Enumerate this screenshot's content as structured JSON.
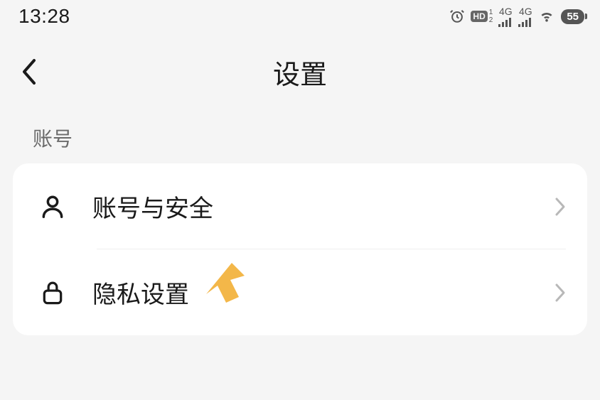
{
  "status": {
    "time": "13:28",
    "hd_label": "HD",
    "sim1": "1",
    "sim2": "2",
    "net1": "4G",
    "net2": "4G",
    "battery": "55"
  },
  "nav": {
    "title": "设置"
  },
  "section": {
    "title": "账号"
  },
  "rows": {
    "account": {
      "label": "账号与安全"
    },
    "privacy": {
      "label": "隐私设置"
    }
  }
}
